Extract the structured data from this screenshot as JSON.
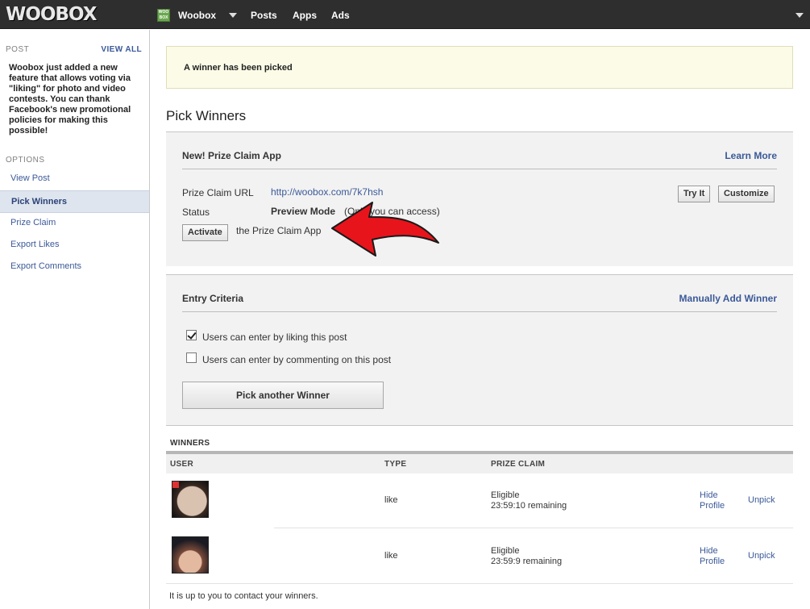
{
  "topbar": {
    "logo": "WOOBOX",
    "app_badge": "WOO BOX",
    "app_name": "Woobox",
    "nav": [
      "Posts",
      "Apps",
      "Ads"
    ]
  },
  "sidebar": {
    "post_heading": "POST",
    "view_all": "VIEW ALL",
    "post_description": "Woobox just added a new feature that allows voting via \"liking\" for photo and video contests. You can thank Facebook's new promotional policies for making this possible!",
    "options_heading": "OPTIONS",
    "items": [
      {
        "label": "View Post",
        "active": false
      },
      {
        "label": "Pick Winners",
        "active": true
      },
      {
        "label": "Prize Claim",
        "active": false
      },
      {
        "label": "Export Likes",
        "active": false
      },
      {
        "label": "Export Comments",
        "active": false
      }
    ]
  },
  "notice": "A winner has been picked",
  "page_title": "Pick Winners",
  "prize_claim": {
    "title": "New! Prize Claim App",
    "learn_more": "Learn More",
    "url_label": "Prize Claim URL",
    "url": "http://woobox.com/7k7hsh",
    "status_label": "Status",
    "status_value": "Preview Mode",
    "status_note": "(Only you can access)",
    "activate": "Activate",
    "activate_suffix": "the Prize Claim App",
    "try_it": "Try It",
    "customize": "Customize"
  },
  "entry_criteria": {
    "title": "Entry Criteria",
    "manual_add": "Manually Add Winner",
    "options": [
      {
        "label": "Users can enter by liking this post",
        "checked": true
      },
      {
        "label": "Users can enter by commenting on this post",
        "checked": false
      }
    ],
    "pick_button": "Pick another Winner"
  },
  "winners": {
    "heading": "WINNERS",
    "columns": [
      "USER",
      "TYPE",
      "PRIZE CLAIM"
    ],
    "rows": [
      {
        "type": "like",
        "claim_status": "Eligible",
        "remaining": "23:59:10 remaining",
        "hide": "Hide Profile",
        "unpick": "Unpick"
      },
      {
        "type": "like",
        "claim_status": "Eligible",
        "remaining": "23:59:9 remaining",
        "hide": "Hide Profile",
        "unpick": "Unpick"
      }
    ],
    "footnote": "It is up to you to contact your winners."
  },
  "colors": {
    "topbar": "#2e2e2e",
    "link": "#3b5998",
    "notice_bg": "#fbfbe7",
    "panel_bg": "#f2f2f2",
    "arrow": "#e8141b"
  }
}
